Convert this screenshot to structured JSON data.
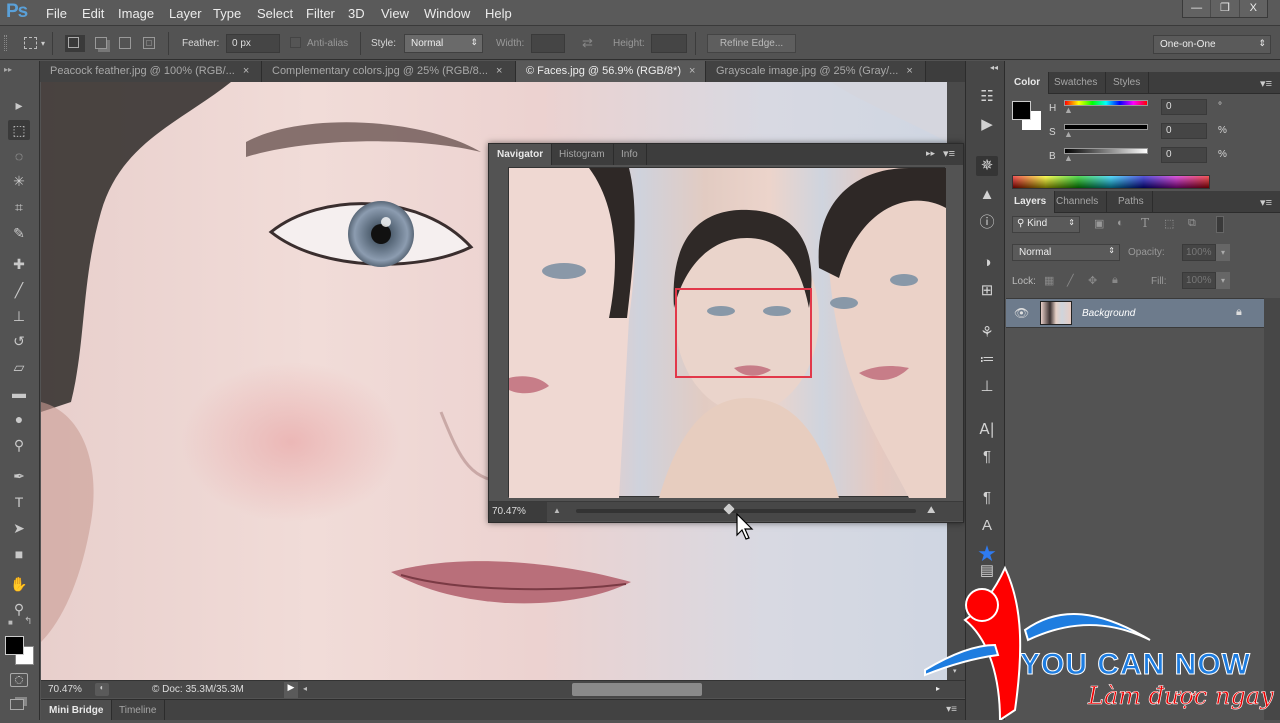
{
  "app": {
    "logo": "Ps"
  },
  "menu": [
    "File",
    "Edit",
    "Image",
    "Layer",
    "Type",
    "Select",
    "Filter",
    "3D",
    "View",
    "Window",
    "Help"
  ],
  "window_controls": {
    "minimize": "—",
    "restore": "❐",
    "close": "X"
  },
  "options_bar": {
    "feather_label": "Feather:",
    "feather_value": "0 px",
    "antialias_label": "Anti-alias",
    "antialias_checked": false,
    "style_label": "Style:",
    "style_value": "Normal",
    "width_label": "Width:",
    "height_label": "Height:",
    "refine_edge": "Refine Edge...",
    "workspace": "One-on-One"
  },
  "doc_tabs": [
    {
      "label": "Peacock feather.jpg @ 100% (RGB/...",
      "active": false
    },
    {
      "label": "Complementary colors.jpg @ 25% (RGB/8...",
      "active": false
    },
    {
      "label": "© Faces.jpg @ 56.9% (RGB/8*)",
      "active": true
    },
    {
      "label": "Grayscale image.jpg @ 25% (Gray/...",
      "active": false
    }
  ],
  "tab_close": "×",
  "tools": [
    {
      "name": "move-tool-icon",
      "glyph": "▸"
    },
    {
      "name": "rectangular-marquee-tool-icon",
      "glyph": "⬚"
    },
    {
      "name": "lasso-tool-icon",
      "glyph": "◌"
    },
    {
      "name": "magic-wand-tool-icon",
      "glyph": "✳"
    },
    {
      "name": "crop-tool-icon",
      "glyph": "⌗"
    },
    {
      "name": "eyedropper-tool-icon",
      "glyph": "✎"
    },
    {
      "name": "healing-brush-tool-icon",
      "glyph": "✚"
    },
    {
      "name": "brush-tool-icon",
      "glyph": "╱"
    },
    {
      "name": "clone-stamp-tool-icon",
      "glyph": "⊥"
    },
    {
      "name": "history-brush-tool-icon",
      "glyph": "↺"
    },
    {
      "name": "eraser-tool-icon",
      "glyph": "▱"
    },
    {
      "name": "gradient-tool-icon",
      "glyph": "▬"
    },
    {
      "name": "blur-tool-icon",
      "glyph": "●"
    },
    {
      "name": "dodge-tool-icon",
      "glyph": "⚲"
    },
    {
      "name": "pen-tool-icon",
      "glyph": "✒"
    },
    {
      "name": "type-tool-icon",
      "glyph": "T"
    },
    {
      "name": "path-selection-tool-icon",
      "glyph": "➤"
    },
    {
      "name": "rectangle-tool-icon",
      "glyph": "■"
    },
    {
      "name": "hand-tool-icon",
      "glyph": "✋"
    },
    {
      "name": "zoom-tool-icon",
      "glyph": "⚲"
    }
  ],
  "colors": {
    "foreground": "#000000",
    "background": "#ffffff",
    "nav_view_box": "#e2384a",
    "layer_selected": "#6d7b8c"
  },
  "navigator": {
    "tabs": [
      "Navigator",
      "Histogram",
      "Info"
    ],
    "zoom_value": "70.47%",
    "zoom_slider_fraction": 0.45
  },
  "color_panel": {
    "tabs": [
      "Color",
      "Swatches",
      "Styles"
    ],
    "h_label": "H",
    "h_value": "0",
    "h_unit": "°",
    "s_label": "S",
    "s_value": "0",
    "s_unit": "%",
    "b_label": "B",
    "b_value": "0",
    "b_unit": "%"
  },
  "layers_panel": {
    "tabs": [
      "Layers",
      "Channels",
      "Paths"
    ],
    "kind_label": "Kind",
    "blend_mode": "Normal",
    "opacity_label": "Opacity:",
    "opacity_value": "100%",
    "lock_label": "Lock:",
    "fill_label": "Fill:",
    "fill_value": "100%",
    "layers": [
      {
        "name": "Background",
        "visible": true,
        "locked": true
      }
    ]
  },
  "status_bar": {
    "zoom": "70.47%",
    "doc_info": "© Doc: 35.3M/35.3M"
  },
  "bottom_tabs": [
    "Mini Bridge",
    "Timeline"
  ],
  "watermark": {
    "title": "YOU CAN NOW",
    "subtitle": "Làm được ngay"
  }
}
